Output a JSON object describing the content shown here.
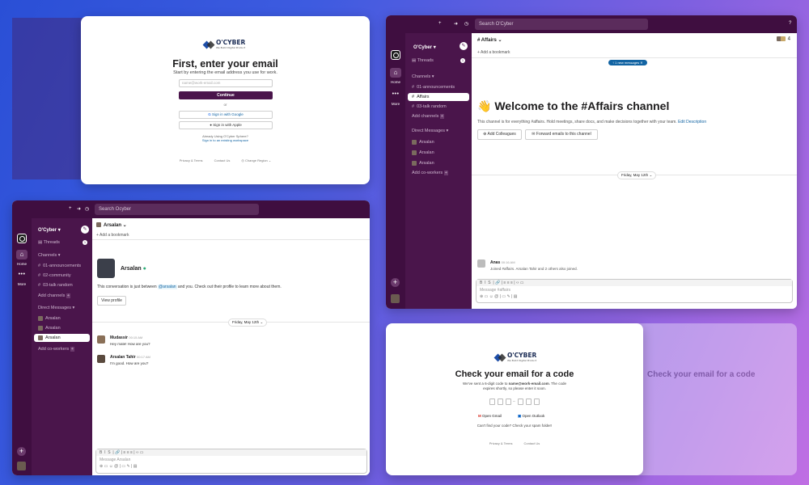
{
  "colors": {
    "aubergine": "#3f0e40",
    "sidebar": "#4a154b",
    "accent_blue": "#1264a3",
    "background_start": "#2a4fd6",
    "background_end": "#c06fe3"
  },
  "brand": {
    "name": "O'CYBER",
    "tagline": "We Build Digital Product"
  },
  "signin": {
    "title": "First, enter your email",
    "subtitle": "Start by entering the email address you use for work.",
    "email_placeholder": "name@work-email.com",
    "continue": "Continue",
    "or": "or",
    "google": "Sign in with Google",
    "apple": "Sign in with Apple",
    "already": "Already Using O'Cyber Sphere?",
    "existing": "Sign in to an existing workspace",
    "footer": [
      "Privacy & Terms",
      "Contact Us",
      "Change Region"
    ]
  },
  "dm_window": {
    "search_placeholder": "Search Ocyber",
    "workspace": "O'Cyber",
    "rail": {
      "home": "Home",
      "more": "More"
    },
    "threads": "Threads",
    "threads_badge": "1",
    "channels_header": "Channels",
    "channels": [
      "01-announcements",
      "02-community",
      "03-talk random"
    ],
    "add_channels": "Add channels",
    "dm_header": "Direct Messages",
    "dms": [
      "Arsalan",
      "Arsalan",
      "Arsalan"
    ],
    "add_coworkers": "Add co-workers",
    "header_name": "Arsalan",
    "bookmark": "Add a bookmark",
    "profile_name": "Arsalan",
    "intro_before": "This conversation is just between",
    "intro_mention": "@arsalan",
    "intro_after": "and you. Check out their profile to learn more about them.",
    "view_profile": "View profile",
    "date_divider": "Friday, May 12th",
    "messages": [
      {
        "name": "Mudassir",
        "time": "00:15 AM",
        "text": "Hey mate! How are you?"
      },
      {
        "name": "Arsalan Tahir",
        "time": "00:17 AM",
        "text": "I'm good. How are you?"
      }
    ],
    "composer_placeholder": "Message Arsalan"
  },
  "channel_window": {
    "search_placeholder": "Search O'Cyber",
    "workspace": "O'Cyber",
    "rail": {
      "home": "Home",
      "more": "More"
    },
    "threads": "Threads",
    "threads_badge": "1",
    "channels_header": "Channels",
    "channels": [
      "01-announcements",
      "Affairs",
      "03-talk random"
    ],
    "add_channels": "Add channels",
    "dm_header": "Direct Messages",
    "dms": [
      "Arsalan",
      "Arsalan",
      "Arsalan"
    ],
    "add_coworkers": "Add co-workers",
    "channel_name": "Affairs",
    "member_count": "4",
    "bookmark": "Add a bookmark",
    "new_messages": "1 new messages",
    "welcome_emoji": "👋",
    "welcome_title": "Welcome to the #Affairs channel",
    "welcome_desc": "This channel is for everything #affairs. Hold meetings, share docs, and make decisions together with your team.",
    "edit_desc": "Edit Description",
    "add_colleagues": "Add Colleagues",
    "forward_emails": "Forward emails to this channel",
    "date_divider": "Friday, May 12th",
    "message": {
      "name": "Anas",
      "time": "00:16 AM",
      "text": "Joined #affairs. Arsalan Tahir and 2 others also joined."
    },
    "composer_placeholder": "Message #affairs"
  },
  "code_card": {
    "title": "Check your email for a code",
    "line1_before": "We've sent a 6-digit code to ",
    "line1_email": "name@work-email.com",
    "line1_after": ". The code",
    "line2": "expires shortly, so please enter it soon.",
    "open_gmail": "Open Gmail",
    "open_outlook": "Open Outlook",
    "spam": "Can't find your code? Check your spam folder!",
    "footer": [
      "Privacy & Terms",
      "Contact Us"
    ]
  }
}
